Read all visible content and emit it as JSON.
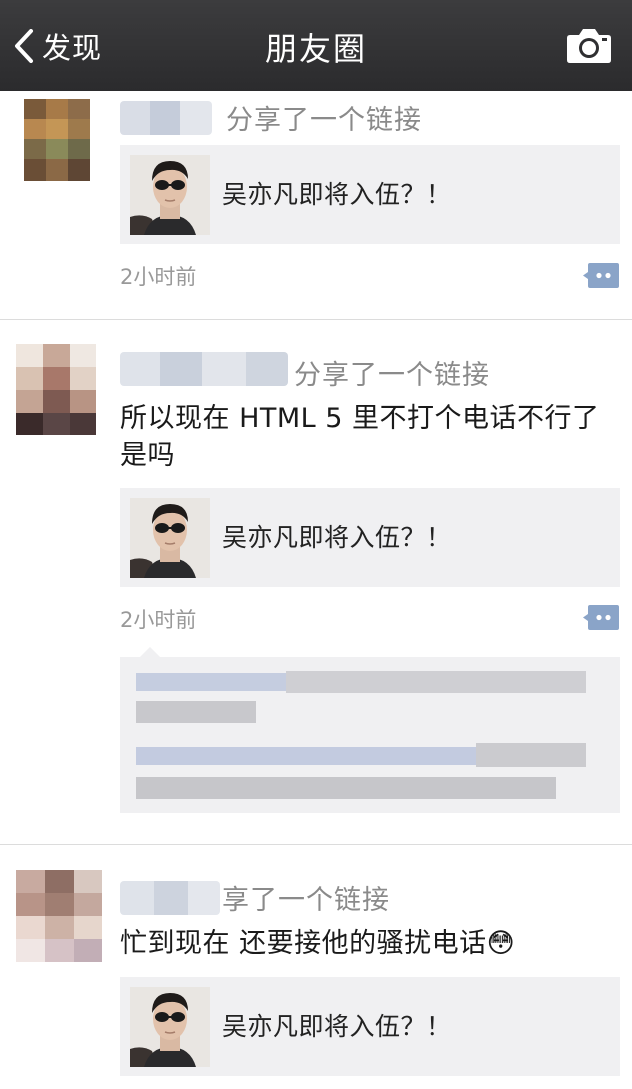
{
  "navbar": {
    "back_label": "发现",
    "title": "朋友圈",
    "camera_icon": "camera-icon"
  },
  "posts": [
    {
      "action_text": "分享了一个链接",
      "body": "",
      "link_title": "吴亦凡即将入伍？！",
      "time": "2小时前"
    },
    {
      "action_text": "分享了一个链接",
      "body": "所以现在 HTML 5 里不打个电话不行了是吗",
      "link_title": "吴亦凡即将入伍？！",
      "time": "2小时前",
      "comments_visible": true
    },
    {
      "action_text": "享了一个链接",
      "body": "忙到现在 还要接他的骚扰电话😳",
      "link_title": "吴亦凡即将入伍？！"
    }
  ],
  "colors": {
    "navbar": "#333335",
    "link_card_bg": "#f0f0f2",
    "comment_icon": "#8aa4c8",
    "timestamp": "#999999"
  }
}
